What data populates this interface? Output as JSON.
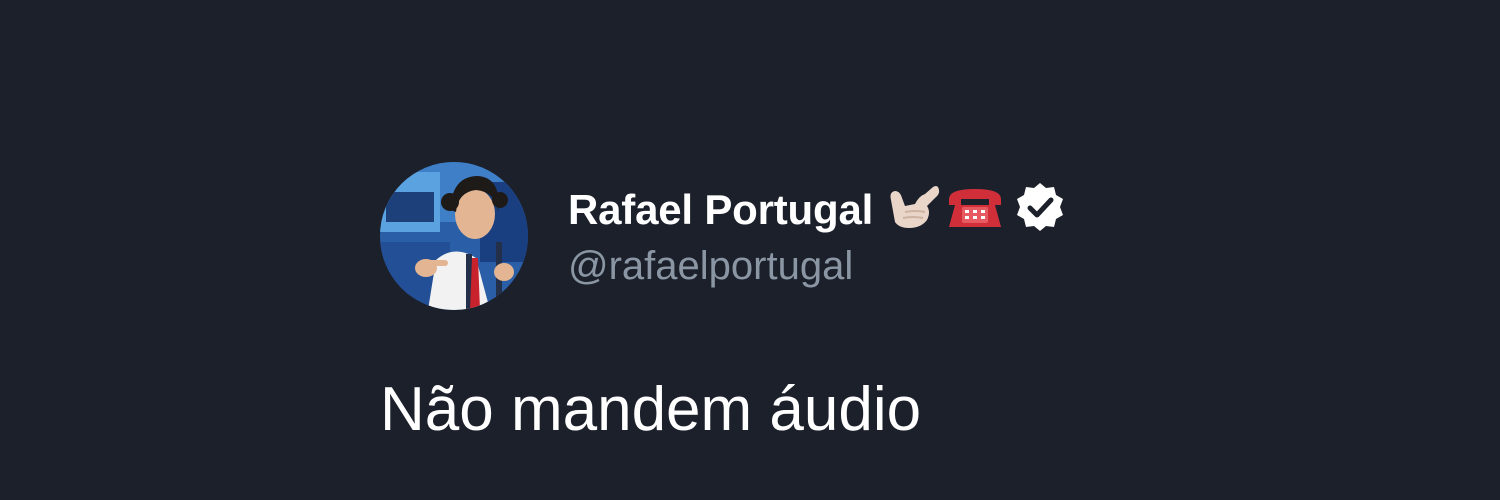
{
  "tweet": {
    "display_name": "Rafael Portugal",
    "name_emojis": [
      "call-me-hand-emoji",
      "telephone-emoji"
    ],
    "verified": true,
    "handle": "@rafaelportugal",
    "text": "Não mandem áudio"
  },
  "colors": {
    "background": "#1b202b",
    "name": "#ffffff",
    "handle": "#8a96a3",
    "text": "#ffffff"
  }
}
